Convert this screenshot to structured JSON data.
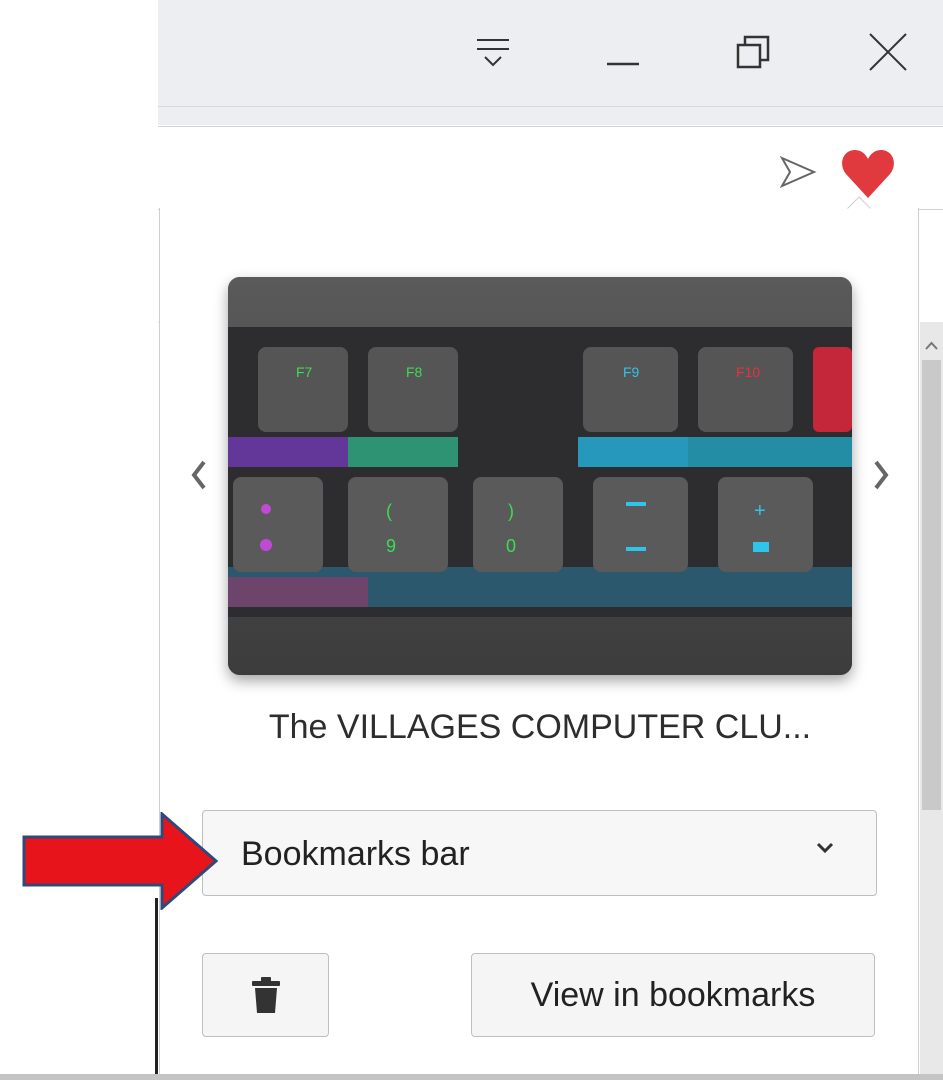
{
  "window": {
    "controls": [
      "tabs-menu-icon",
      "minimize-icon",
      "restore-icon",
      "close-icon"
    ]
  },
  "addressbar": {
    "icons": [
      "send-icon",
      "heart-icon"
    ],
    "heart_color": "#e0393e"
  },
  "bookmark_popup": {
    "title": "The VILLAGES COMPUTER CLU...",
    "folder": "Bookmarks bar",
    "delete_icon": "trash-icon",
    "view_button": "View in bookmarks"
  },
  "annotation": {
    "arrow_color": "#e8141b"
  }
}
